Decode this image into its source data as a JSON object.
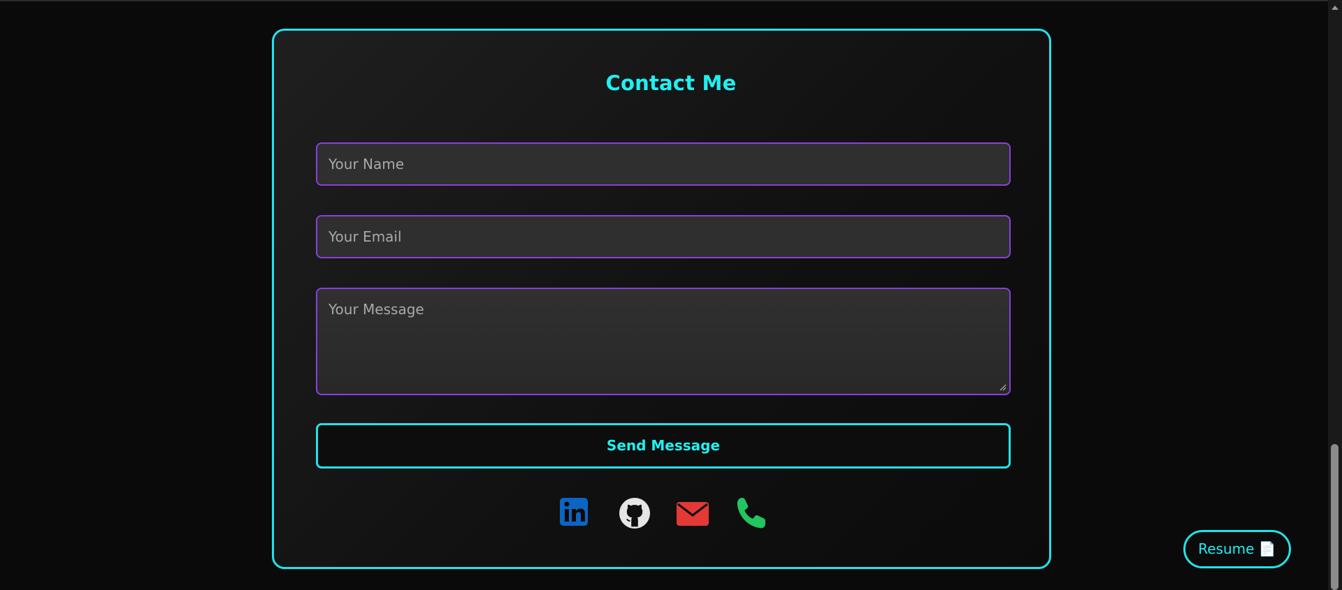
{
  "contact": {
    "title": "Contact Me",
    "name_placeholder": "Your Name",
    "email_placeholder": "Your Email",
    "message_placeholder": "Your Message",
    "send_label": "Send Message",
    "socials": [
      {
        "icon": "linkedin-icon",
        "color": "#0a66c2"
      },
      {
        "icon": "github-icon",
        "color": "#e6e6e6"
      },
      {
        "icon": "email-icon",
        "color": "#e53935"
      },
      {
        "icon": "phone-icon",
        "color": "#22c55e"
      }
    ]
  },
  "resume": {
    "label": "Resume 📄"
  },
  "colors": {
    "accent": "#1ff0f2",
    "field_border": "#8a3fe0",
    "background": "#0a0a0a"
  }
}
